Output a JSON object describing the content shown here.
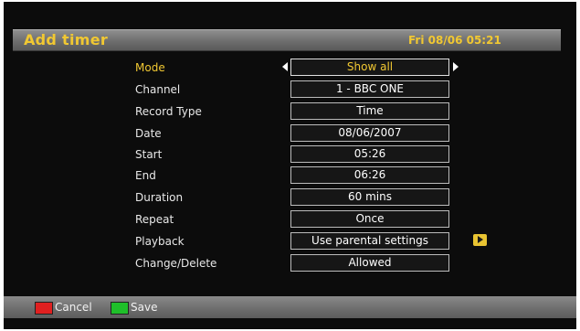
{
  "header": {
    "title": "Add timer",
    "datetime": "Fri 08/06 05:21"
  },
  "rows": [
    {
      "label": "Mode",
      "value": "Show all",
      "selected": true
    },
    {
      "label": "Channel",
      "value": "1 - BBC ONE"
    },
    {
      "label": "Record Type",
      "value": "Time"
    },
    {
      "label": "Date",
      "value": "08/06/2007"
    },
    {
      "label": "Start",
      "value": "05:26"
    },
    {
      "label": "End",
      "value": "06:26"
    },
    {
      "label": "Duration",
      "value": "60 mins"
    },
    {
      "label": "Repeat",
      "value": "Once"
    },
    {
      "label": "Playback",
      "value": "Use parental settings",
      "icon": "yellow-play-icon"
    },
    {
      "label": "Change/Delete",
      "value": "Allowed"
    }
  ],
  "footer": {
    "cancel": {
      "label": "Cancel",
      "color": "#e02020"
    },
    "save": {
      "label": "Save",
      "color": "#1fbf2a"
    }
  },
  "colors": {
    "accent": "#f1c832",
    "background": "#0c0c0c"
  }
}
